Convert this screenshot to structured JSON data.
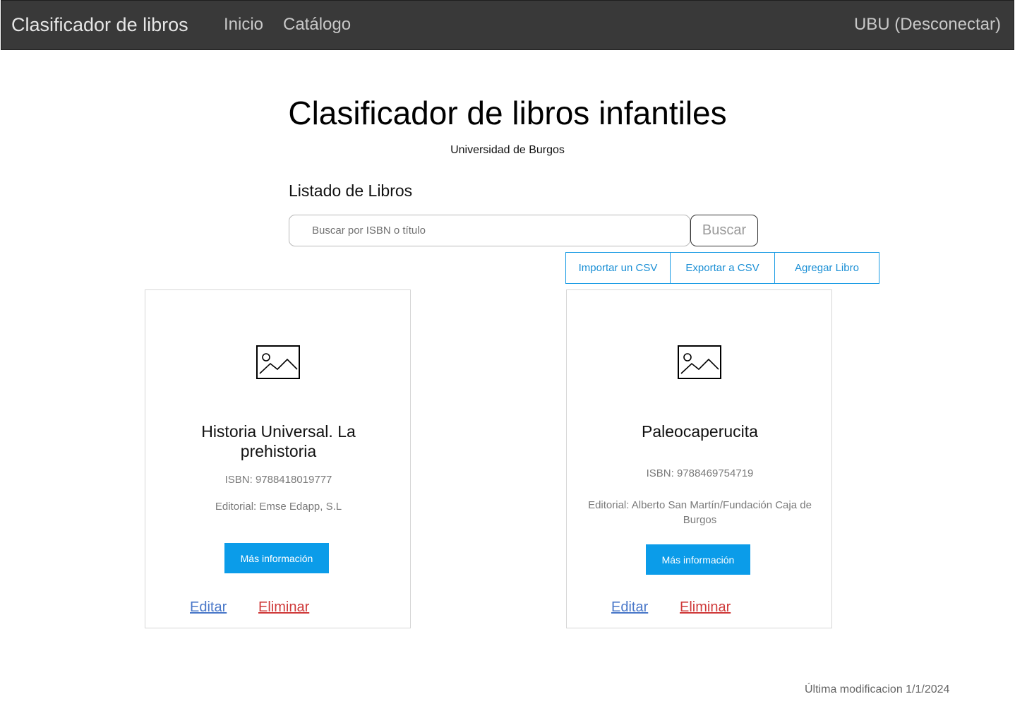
{
  "navbar": {
    "brand": "Clasificador de libros",
    "links": [
      "Inicio",
      "Catálogo"
    ],
    "user_link": "UBU (Desconectar)"
  },
  "header": {
    "title": "Clasificador de libros infantiles",
    "subtitle": "Universidad de Burgos"
  },
  "listing": {
    "section_title": "Listado de Libros",
    "search_placeholder": "Buscar por ISBN o título",
    "search_button": "Buscar",
    "actions": [
      "Importar un CSV",
      "Exportar a CSV",
      "Agregar Libro"
    ]
  },
  "books": [
    {
      "title": "Historia Universal. La prehistoria",
      "isbn": "ISBN: 9788418019777",
      "publisher": "Editorial: Emse Edapp, S.L",
      "more_button": "Más información",
      "edit_link": "Editar",
      "delete_link": "Eliminar",
      "image_icon": "image-placeholder-icon"
    },
    {
      "title": "Paleocaperucita",
      "isbn": "ISBN: 9788469754719",
      "publisher": "Editorial: Alberto San Martín/Fundación Caja de Burgos",
      "more_button": "Más información",
      "edit_link": "Editar",
      "delete_link": "Eliminar",
      "image_icon": "image-placeholder-icon"
    }
  ],
  "footer": {
    "last_modified": "Última modificacion 1/1/2024"
  },
  "colors": {
    "navbar_bg": "#393939",
    "accent": "#0b9ce9",
    "edit_link": "#4a78c9",
    "delete_link": "#cf3a3a"
  }
}
